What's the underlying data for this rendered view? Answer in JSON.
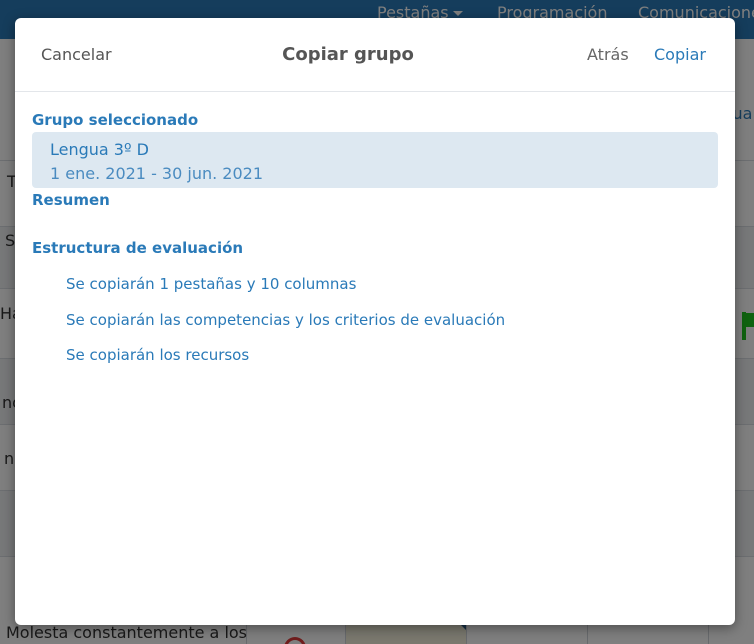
{
  "app": {
    "nav": {
      "tabs_menu": "Pestañas",
      "programacion": "Programación",
      "comunicaciones": "Comunicaciones"
    },
    "eval_fragment": "lua",
    "row_labels": [
      "T",
      "S",
      "Ha",
      "no",
      "no"
    ],
    "bottom_row_text": "Molesta constantemente a los"
  },
  "modal": {
    "title": "Copiar grupo",
    "cancel_label": "Cancelar",
    "back_label": "Atrás",
    "copy_label": "Copiar",
    "selected_group_heading": "Grupo seleccionado",
    "selected_group": {
      "name": "Lengua 3º D",
      "dates": "1 ene. 2021 - 30 jun. 2021"
    },
    "summary_heading": "Resumen",
    "structure_heading": "Estructura de evaluación",
    "structure_items": [
      "Se copiarán 1 pestañas y 10 columnas",
      "Se copiarán las competencias y los criterios de evaluación",
      "Se copiarán los recursos"
    ]
  },
  "colors": {
    "brand": "#2a7ab8",
    "selected_bg": "#dde8f1",
    "flag": "#1ec51e",
    "alert": "#e03b3b"
  }
}
